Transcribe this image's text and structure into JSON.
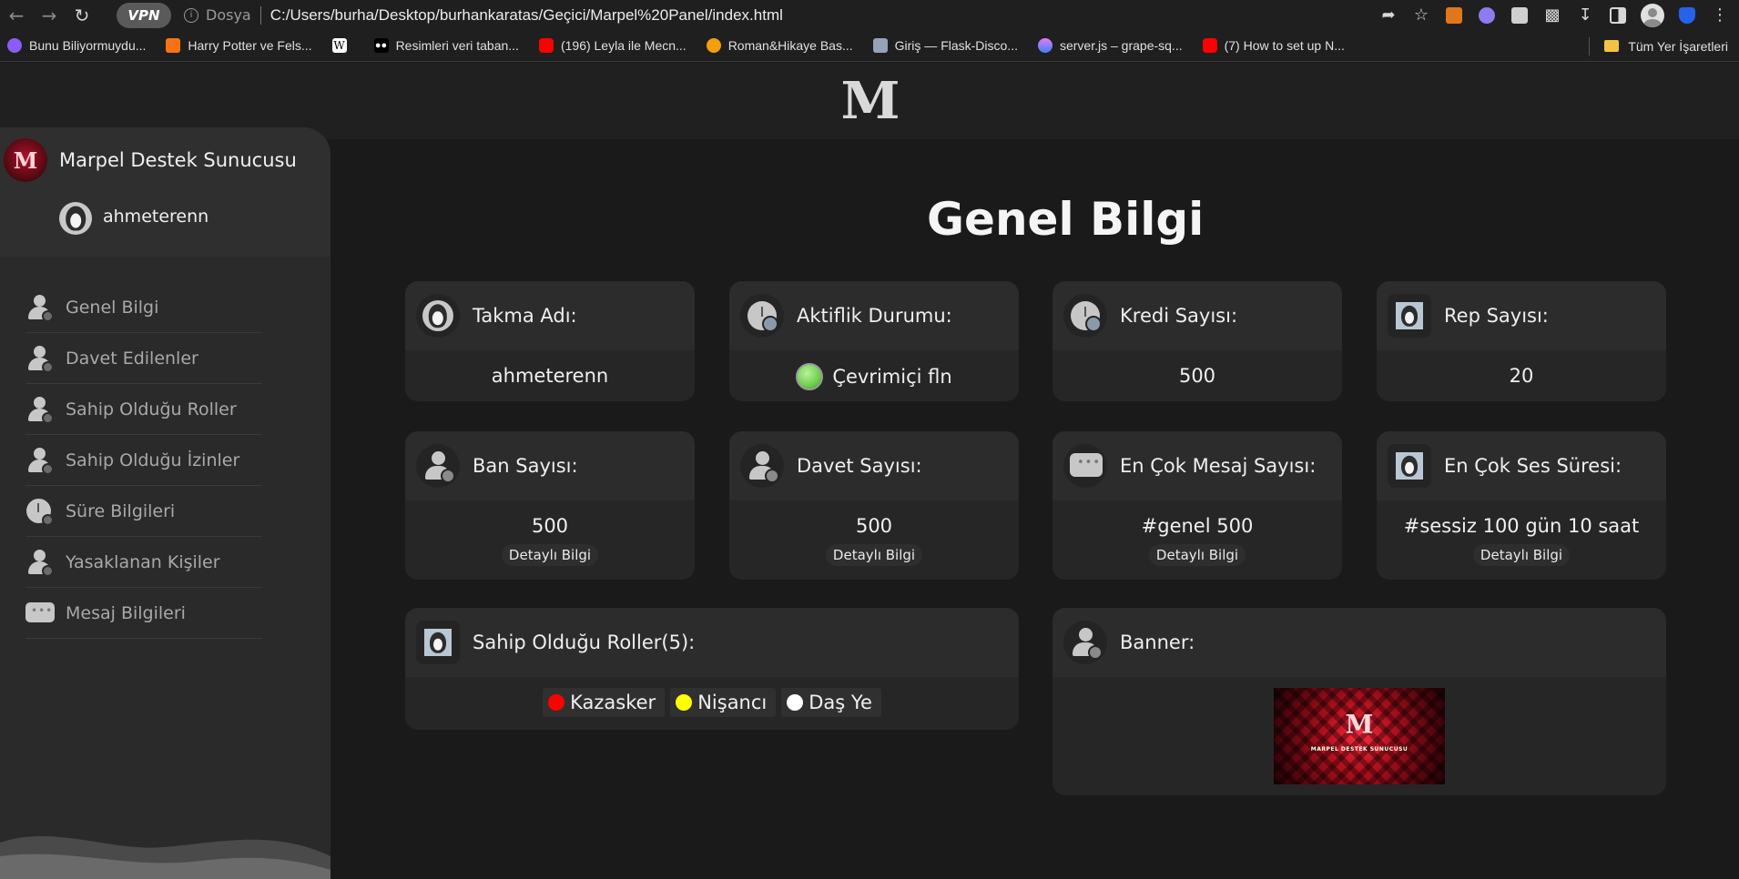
{
  "browser": {
    "vpn_label": "VPN",
    "file_label": "Dosya",
    "url": "C:/Users/burha/Desktop/burhankaratas/Geçici/Marpel%20Panel/index.html",
    "bookmarks": [
      {
        "label": "Bunu Biliyormuydu...",
        "icon": "heart-icon",
        "color": "#8b5cf6"
      },
      {
        "label": "Harry Potter ve Fels...",
        "icon": "flame-icon",
        "color": "#f97316"
      },
      {
        "label": "",
        "icon": "wikipedia-icon",
        "color": "#ffffff"
      },
      {
        "label": "Resimleri veri taban...",
        "icon": "medium-icon",
        "color": "#ffffff"
      },
      {
        "label": "(196) Leyla ile Mecn...",
        "icon": "youtube-icon",
        "color": "#ff0000"
      },
      {
        "label": "Roman&Hikaye Bas...",
        "icon": "wattpad-icon",
        "color": "#f59e0b"
      },
      {
        "label": "Giriş — Flask-Disco...",
        "icon": "docs-icon",
        "color": "#94a3b8"
      },
      {
        "label": "server.js – grape-sq...",
        "icon": "glitch-icon",
        "color": "#e879f9"
      },
      {
        "label": "(7) How to set up N...",
        "icon": "youtube-icon",
        "color": "#ff0000"
      }
    ],
    "all_bookmarks": "Tüm Yer İşaretleri"
  },
  "brand": {
    "logo": "M"
  },
  "sidebar": {
    "server_name": "Marpel Destek Sunucusu",
    "server_avatar_letter": "M",
    "user_name": "ahmeterenn",
    "items": [
      {
        "label": "Genel Bilgi",
        "icon": "user-info-icon"
      },
      {
        "label": "Davet Edilenler",
        "icon": "user-add-icon"
      },
      {
        "label": "Sahip Olduğu Roller",
        "icon": "user-role-icon"
      },
      {
        "label": "Sahip Olduğu İzinler",
        "icon": "user-key-icon"
      },
      {
        "label": "Süre Bilgileri",
        "icon": "clock-icon"
      },
      {
        "label": "Yasaklanan Kişiler",
        "icon": "user-ban-icon"
      },
      {
        "label": "Mesaj Bilgileri",
        "icon": "chat-icon"
      }
    ]
  },
  "main": {
    "title": "Genel Bilgi",
    "cards": {
      "nickname": {
        "title": "Takma Adı:",
        "value": "ahmeterenn"
      },
      "activity": {
        "title": "Aktiflik Durumu:",
        "value": "Çevrimiçi fln"
      },
      "credits": {
        "title": "Kredi Sayısı:",
        "value": "500"
      },
      "rep": {
        "title": "Rep Sayısı:",
        "value": "20"
      },
      "bans": {
        "title": "Ban Sayısı:",
        "value": "500",
        "button": "Detaylı Bilgi"
      },
      "invites": {
        "title": "Davet Sayısı:",
        "value": "500",
        "button": "Detaylı Bilgi"
      },
      "messages": {
        "title": "En Çok Mesaj Sayısı:",
        "value": "#genel 500",
        "button": "Detaylı Bilgi"
      },
      "voice": {
        "title": "En Çok Ses Süresi:",
        "value": "#sessiz 100 gün 10 saat",
        "button": "Detaylı Bilgi"
      },
      "roles": {
        "title": "Sahip Olduğu Roller(5):",
        "items": [
          {
            "label": "Kazasker",
            "color": "#ff0000"
          },
          {
            "label": "Nişancı",
            "color": "#ffff00"
          },
          {
            "label": "Daş Ye",
            "color": "#ffffff"
          }
        ]
      },
      "banner": {
        "title": "Banner:",
        "image_text": "MARPEL DESTEK SUNUCUSU",
        "image_logo": "M"
      }
    }
  }
}
